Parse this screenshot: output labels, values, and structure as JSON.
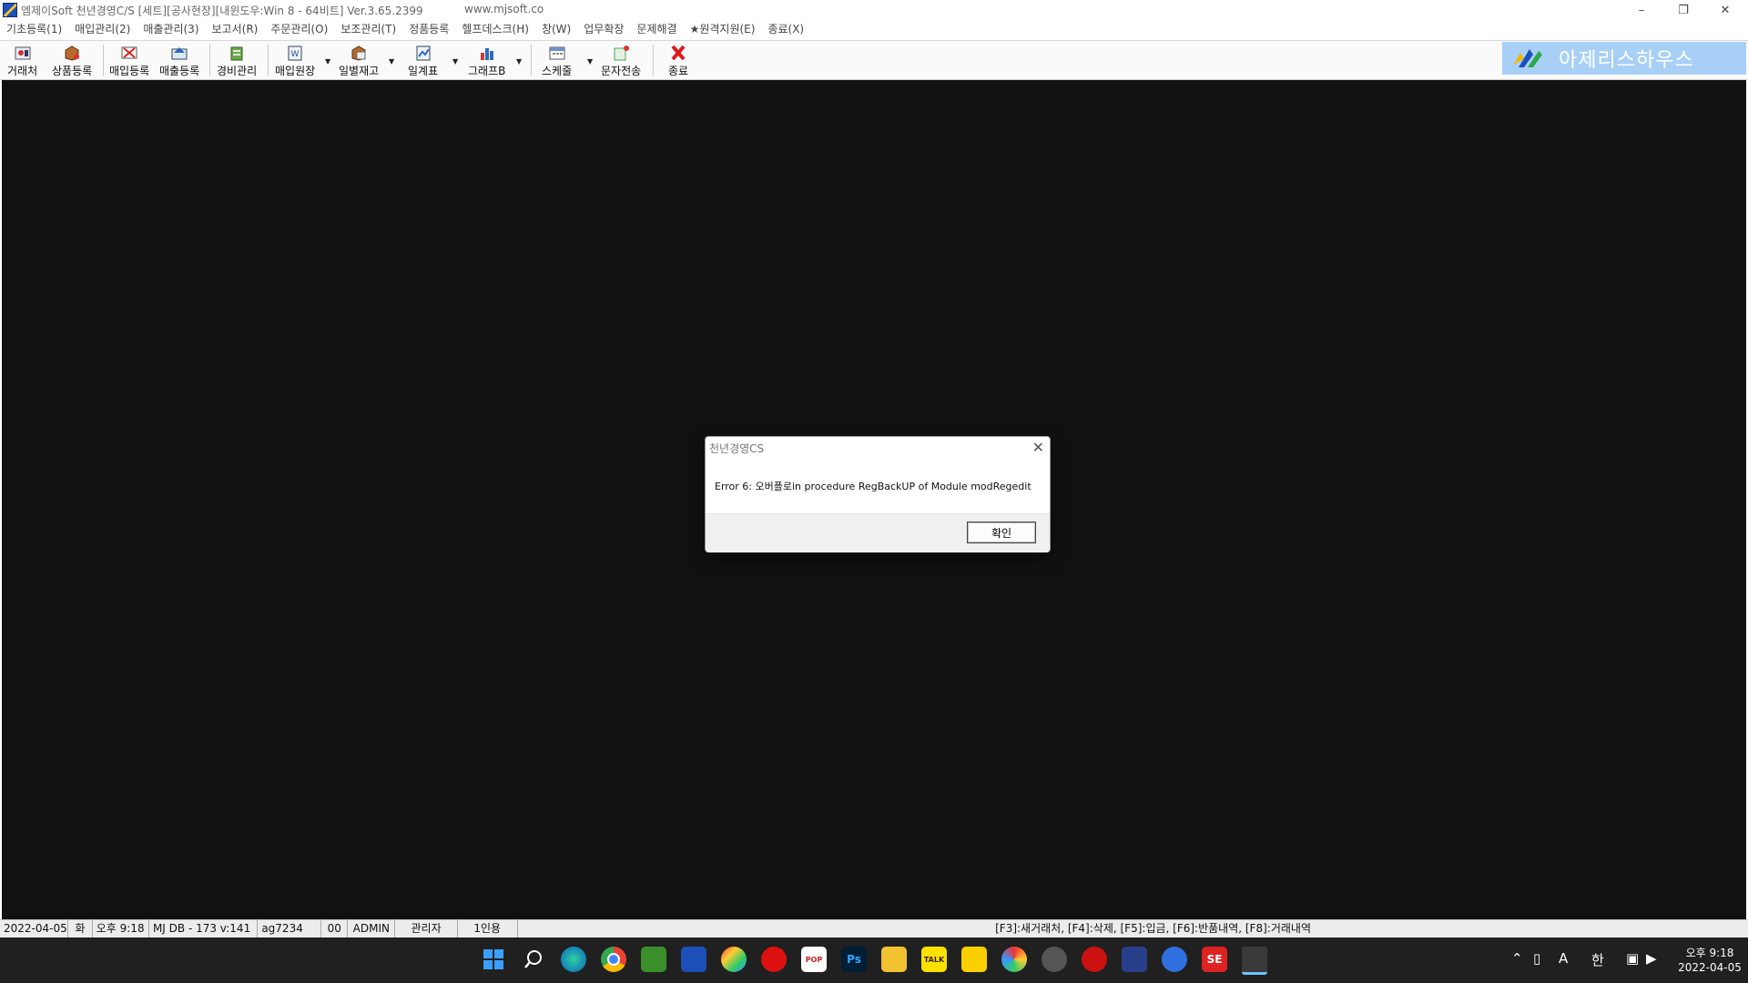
{
  "window": {
    "title": "엠제이Soft 천년경영C/S [세트][공사현장][내윈도우:Win 8 - 64비트] Ver.3.65.2399",
    "url": "www.mjsoft.co"
  },
  "menu": [
    "기초등록(1)",
    "매입관리(2)",
    "매출관리(3)",
    "보고서(R)",
    "주문관리(O)",
    "보조관리(T)",
    "정품등록",
    "헬프데스크(H)",
    "창(W)",
    "업무확장",
    "문제해결",
    "★원격지원(E)",
    "종료(X)"
  ],
  "toolbar": {
    "client": "거래처",
    "product": "상품등록",
    "purchase": "매입등록",
    "sales": "매출등록",
    "expense": "경비관리",
    "ledger": "매입원장",
    "daily_stock": "일별재고",
    "daily_table": "일계표",
    "graph": "그래프B",
    "schedule": "스케줄",
    "sms": "문자전송",
    "exit": "종료"
  },
  "brand": {
    "name": "아제리스하우스"
  },
  "dialog": {
    "title": "천년경영CS",
    "message": "Error 6: 오버플로in procedure RegBackUP of Module modRegedit",
    "ok": "확인"
  },
  "status": {
    "date": "2022-04-05",
    "weekday": "화",
    "time": "오후 9:18",
    "db": "MJ DB - 173 v:141",
    "code": "ag7234",
    "num": "00",
    "user": "ADMIN",
    "role": "관리자",
    "users": "1인용",
    "shortcuts": "[F3]:새거래처, [F4]:삭제, [F5]:입금, [F6]:반품내역, [F8]:거래내역"
  },
  "taskbar": {
    "lang": "한",
    "ime": "A",
    "clock_time": "오후 9:18",
    "clock_date": "2022-04-05"
  }
}
